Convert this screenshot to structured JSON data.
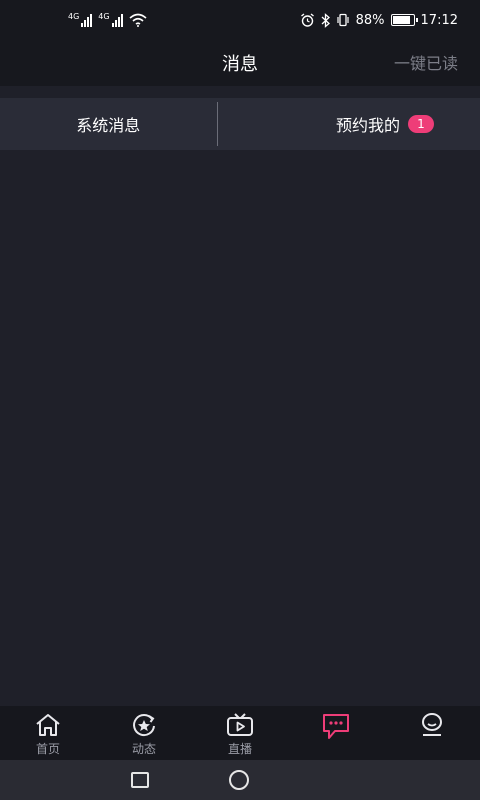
{
  "statusbar": {
    "net1": "4G",
    "net2": "4G",
    "battery_percent": "88%",
    "battery_level": 0.88,
    "time": "17:12"
  },
  "header": {
    "title": "消息",
    "mark_all_read": "一键已读"
  },
  "tabs": {
    "system_messages": "系统消息",
    "my_reservations": "预约我的",
    "reservations_badge": "1"
  },
  "bottom_nav": {
    "items": [
      {
        "label": "首页",
        "icon": "home-icon"
      },
      {
        "label": "动态",
        "icon": "moments-star-icon"
      },
      {
        "label": "直播",
        "icon": "tv-play-icon"
      },
      {
        "label": "",
        "icon": "chat-bubble-icon"
      },
      {
        "label": "",
        "icon": "profile-icon"
      }
    ]
  },
  "colors": {
    "background": "#1f2029",
    "tab_bar": "#2a2c37",
    "accent": "#ee3d78",
    "muted_text": "#7c7e88"
  }
}
